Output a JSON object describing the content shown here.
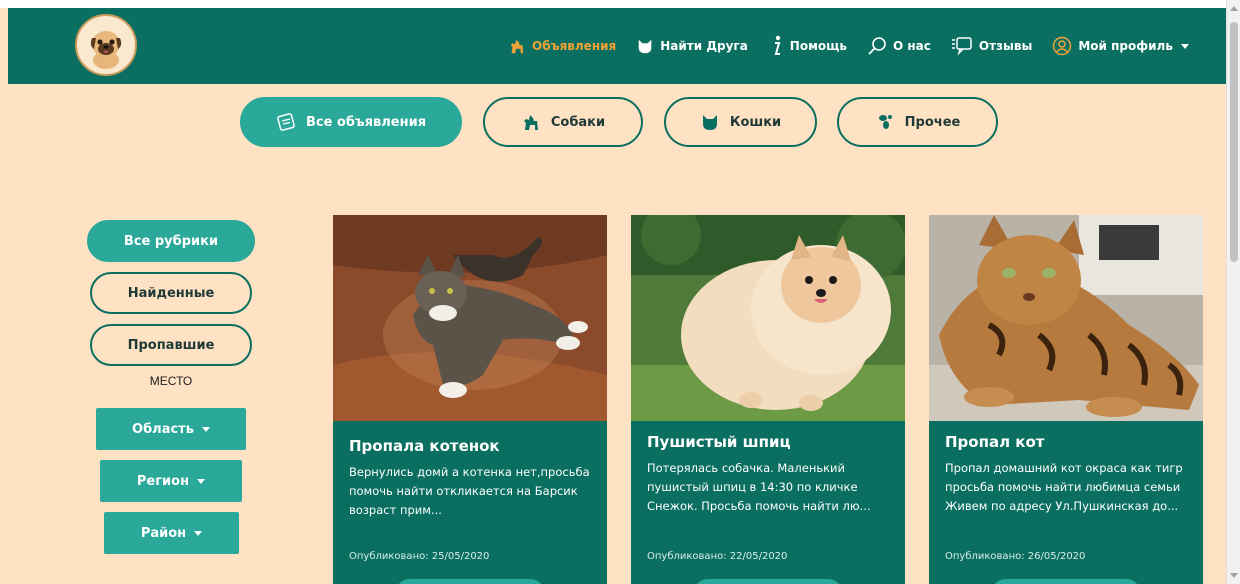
{
  "nav": {
    "items": [
      {
        "label": "Объявления",
        "icon": "dog-icon",
        "active": true
      },
      {
        "label": "Найти Друга",
        "icon": "cat-icon"
      },
      {
        "label": "Помощь",
        "icon": "info-icon"
      },
      {
        "label": "О нас",
        "icon": "search-icon"
      },
      {
        "label": "Отзывы",
        "icon": "chat-icon"
      },
      {
        "label": "Мой профиль",
        "icon": "user-icon"
      }
    ]
  },
  "categories": [
    {
      "label": "Все объявления",
      "icon": "ads-icon"
    },
    {
      "label": "Собаки",
      "icon": "dog-icon"
    },
    {
      "label": "Кошки",
      "icon": "cat-icon"
    },
    {
      "label": "Прочее",
      "icon": "other-pets-icon"
    }
  ],
  "sidebar": {
    "rubrics": [
      {
        "label": "Все рубрики"
      },
      {
        "label": "Найденные"
      },
      {
        "label": "Пропавшие"
      }
    ],
    "place_label": "МЕСТО",
    "dropdowns": [
      {
        "label": "Область"
      },
      {
        "label": "Регион"
      },
      {
        "label": "Район"
      }
    ]
  },
  "cards": [
    {
      "title": "Пропала котенок",
      "text": "Вернулись домй а котенка нет,просьба помочь найти отклик­ается на Барсик возраст прим...",
      "date": "Опубликовано: 25/05/2020"
    },
    {
      "title": "Пушистый шпиц",
      "text": "Потерялась собачка. Маленький пушистый шпиц в 14:30 по кличке Снежок. Просьба помочь найти лю...",
      "date": "Опубликовано: 22/05/2020"
    },
    {
      "title": "Пропал кот",
      "text": "Пропал домашний кот окраса как тигр просьба помочь найти любимца семьи Живем по адресу Ул.Пушкинская до...",
      "date": "Опубликовано: 26/05/2020"
    }
  ],
  "colors": {
    "primary": "#0a6f60",
    "accent": "#2aa899",
    "background": "#ffe2c3",
    "active_nav": "#f0a236"
  }
}
